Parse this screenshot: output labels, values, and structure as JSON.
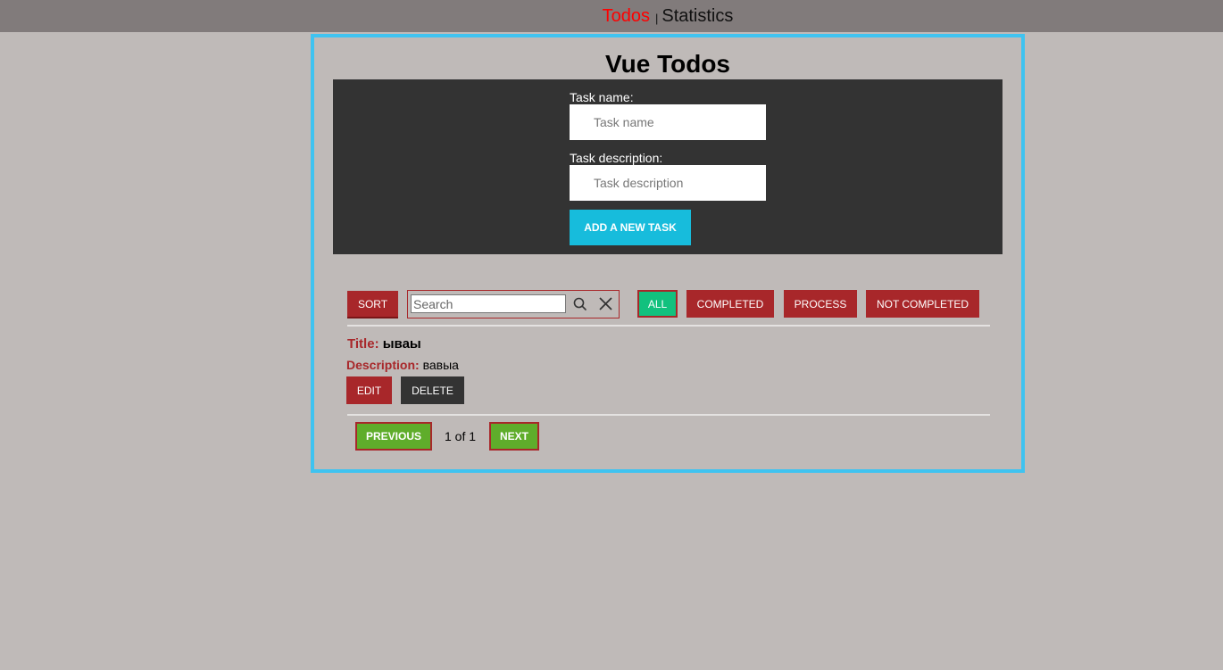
{
  "nav": {
    "todos_label": "Todos",
    "separator": "|",
    "statistics_label": "Statistics"
  },
  "app": {
    "title": "Vue Todos"
  },
  "form": {
    "task_name_label": "Task name:",
    "task_name_placeholder": "Task name",
    "task_description_label": "Task description:",
    "task_description_placeholder": "Task description",
    "add_button": "ADD A NEW TASK"
  },
  "toolbar": {
    "sort_button": "SORT",
    "search_placeholder": "Search",
    "filters": {
      "all": "ALL",
      "completed": "COMPLETED",
      "process": "PROCESS",
      "not_completed": "NOT COMPLETED"
    }
  },
  "task": {
    "title_label": "Title:",
    "title_value": "ываы",
    "description_label": "Description:",
    "description_value": "вавыа",
    "edit_button": "EDIT",
    "delete_button": "DELETE"
  },
  "pagination": {
    "previous": "PREVIOUS",
    "page_info": "1 of 1",
    "next": "NEXT"
  },
  "colors": {
    "accent_red": "#a8272a",
    "active_filter": "#12c17e",
    "add_button": "#17bcdc",
    "frame_border": "#3fc3f0",
    "pagination_green": "#5fad2b"
  },
  "icons": {
    "search": "search-icon",
    "clear": "close-icon"
  }
}
